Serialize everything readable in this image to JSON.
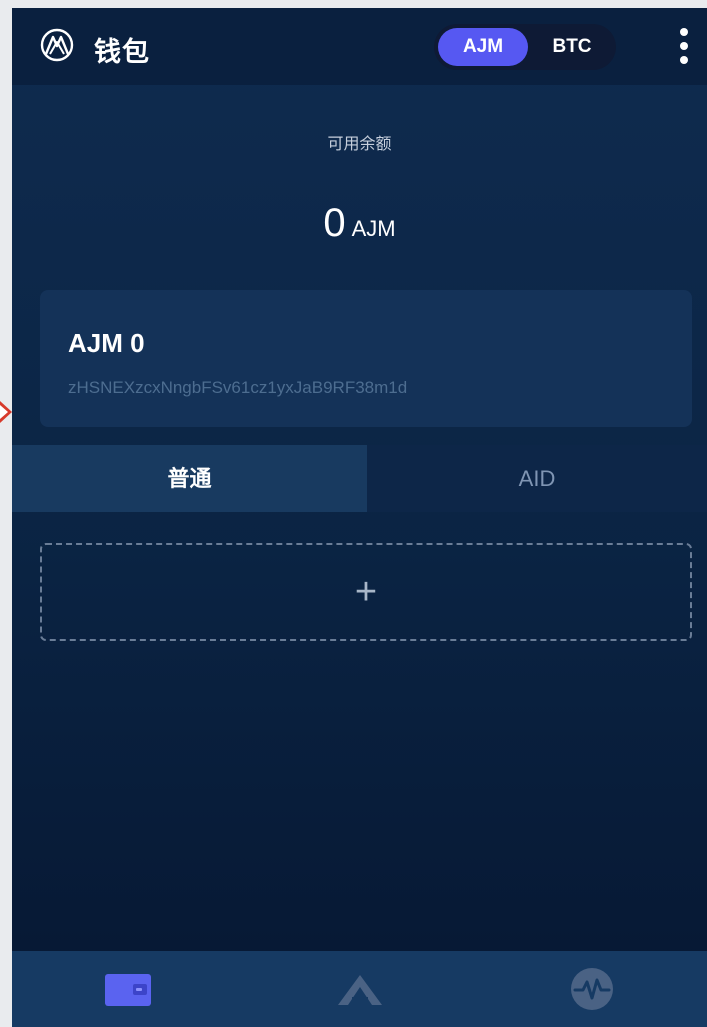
{
  "header": {
    "title": "钱包",
    "logo_icon": "app-logo-icon",
    "currencies": [
      "AJM",
      "BTC"
    ],
    "active_currency": "AJM",
    "menu_icon": "more-vertical-icon"
  },
  "balance": {
    "label": "可用余额",
    "value": "0",
    "unit": "AJM"
  },
  "account": {
    "name": "AJM 0",
    "address": "zHSNEXzcxNngbFSv61cz1yxJaB9RF38m1d"
  },
  "tabs": [
    {
      "label": "普通",
      "active": true
    },
    {
      "label": "AID",
      "active": false
    }
  ],
  "add_card": {
    "icon": "plus-icon",
    "symbol": "+"
  },
  "bottom_nav": [
    {
      "icon": "wallet-icon",
      "active": true
    },
    {
      "icon": "explore-icon",
      "active": false
    },
    {
      "icon": "pulse-icon",
      "active": false
    }
  ],
  "colors": {
    "accent": "#5658f2",
    "background": "#0b2545",
    "card": "#143258",
    "nav_active": "#5a63f0",
    "nav_inactive": "#4a6284"
  }
}
